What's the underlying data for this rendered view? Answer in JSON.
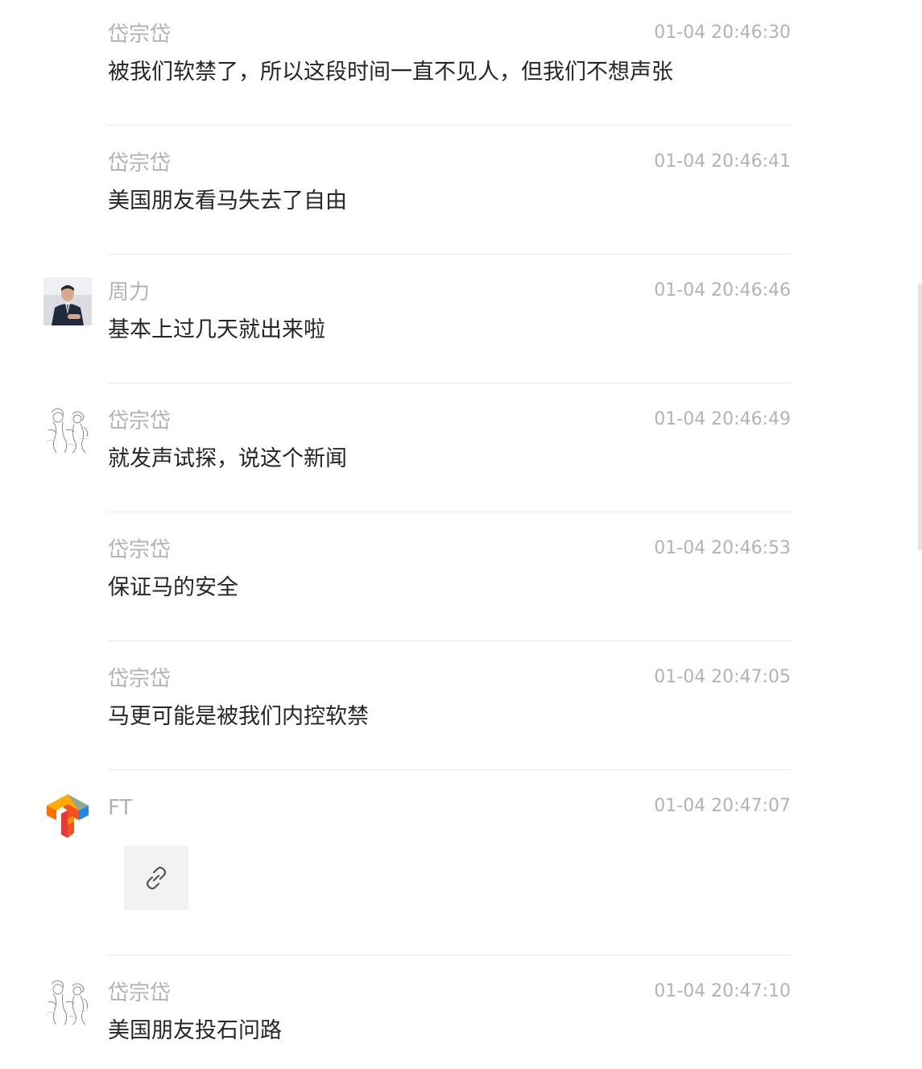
{
  "messages": [
    {
      "name": "岱宗岱",
      "time": "01-04 20:46:30",
      "text": "被我们软禁了，所以这段时间一直不见人，但我们不想声张",
      "avatar": "none"
    },
    {
      "name": "岱宗岱",
      "time": "01-04 20:46:41",
      "text": "美国朋友看马失去了自由",
      "avatar": "none"
    },
    {
      "name": "周力",
      "time": "01-04 20:46:46",
      "text": "基本上过几天就出来啦",
      "avatar": "photo-man-in-suit"
    },
    {
      "name": "岱宗岱",
      "time": "01-04 20:46:49",
      "text": "就发声试探，说这个新闻",
      "avatar": "sketch-drawing"
    },
    {
      "name": "岱宗岱",
      "time": "01-04 20:46:53",
      "text": "保证马的安全",
      "avatar": "none"
    },
    {
      "name": "岱宗岱",
      "time": "01-04 20:47:05",
      "text": "马更可能是被我们内控软禁",
      "avatar": "none"
    },
    {
      "name": "FT",
      "time": "01-04 20:47:07",
      "text": "",
      "avatar": "ft-logo",
      "attachment": "link-icon"
    },
    {
      "name": "岱宗岱",
      "time": "01-04 20:47:10",
      "text": "美国朋友投石问路",
      "avatar": "sketch-drawing"
    }
  ],
  "colors": {
    "name": "#b3b3b3",
    "time": "#b3b3b3",
    "text": "#262626",
    "divider": "#e8e8e8",
    "link_card_bg": "#f2f2f2"
  }
}
